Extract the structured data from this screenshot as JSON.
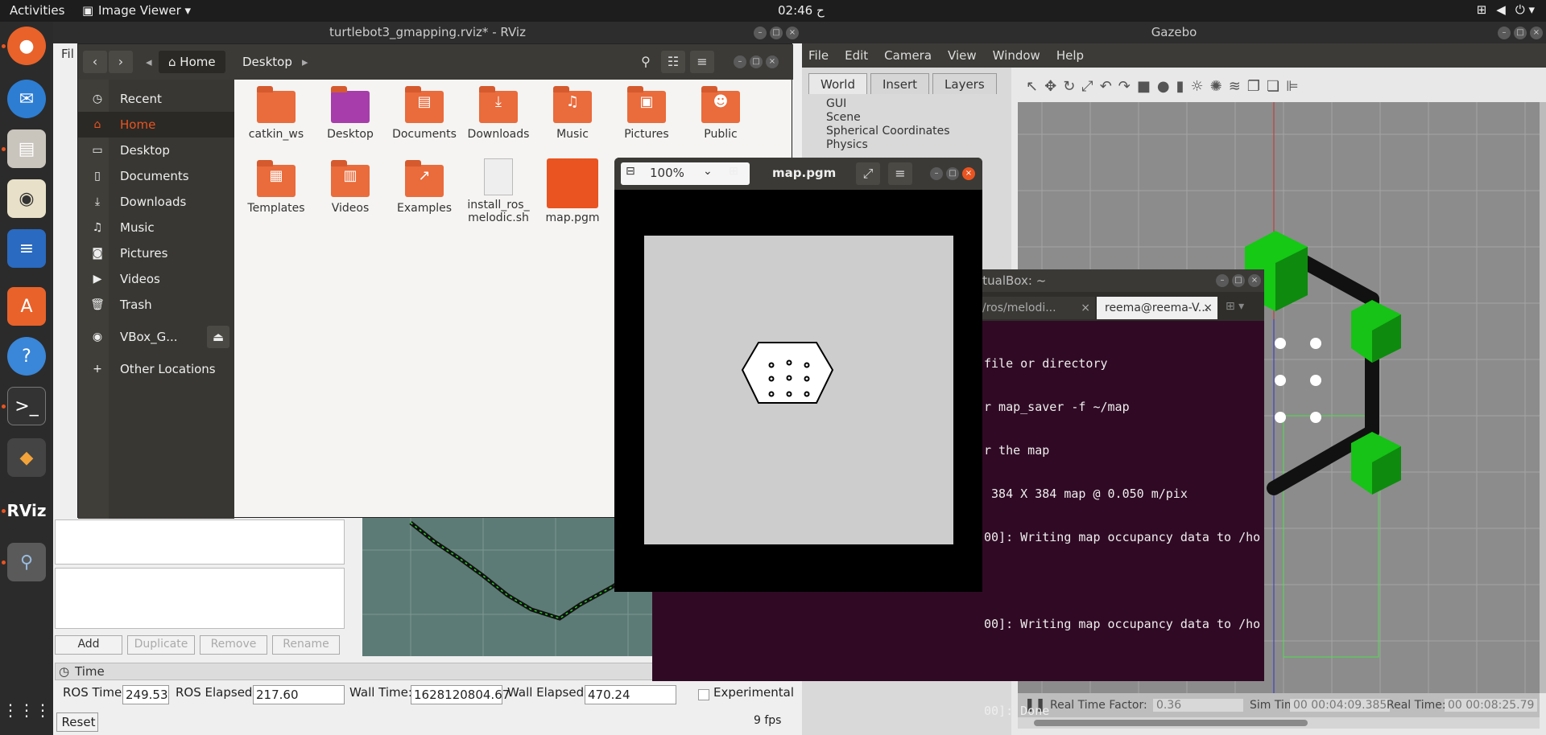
{
  "topbar": {
    "activities": "Activities",
    "app_menu": "Image Viewer ▾",
    "clock": "02:46 ح"
  },
  "dock": {
    "icons": [
      "firefox-icon",
      "thunderbird-icon",
      "files-icon",
      "rhythmbox-icon",
      "writer-icon",
      "software-icon",
      "help-icon",
      "terminal-icon",
      "virtualbox-icon",
      "rviz-icon",
      "image-viewer-icon",
      "app-grid-icon"
    ]
  },
  "rviz": {
    "window_title": "turtlebot3_gmapping.rviz* - RViz",
    "menu_file": "Fil"
  },
  "gazebo": {
    "window_title": "Gazebo",
    "menu": [
      "File",
      "Edit",
      "Camera",
      "View",
      "Window",
      "Help"
    ],
    "tabs": [
      "World",
      "Insert",
      "Layers"
    ],
    "tree": [
      "GUI",
      "Scene",
      "Spherical Coordinates",
      "Physics"
    ],
    "status": {
      "rtf_label": "Real Time Factor:",
      "rtf_value": "0.36",
      "sim_label": "Sim Time:",
      "sim_value": "00 00:04:09.385",
      "real_label": "Real Time:",
      "real_value": "00 00:08:25.79"
    }
  },
  "files": {
    "path_home": "Home",
    "path_desktop": "Desktop",
    "sidebar": [
      {
        "label": "Recent"
      },
      {
        "label": "Home"
      },
      {
        "label": "Desktop"
      },
      {
        "label": "Documents"
      },
      {
        "label": "Downloads"
      },
      {
        "label": "Music"
      },
      {
        "label": "Pictures"
      },
      {
        "label": "Videos"
      },
      {
        "label": "Trash"
      },
      {
        "label": "VBox_G..."
      },
      {
        "label": "Other Locations"
      }
    ],
    "items": [
      {
        "label": "catkin_ws"
      },
      {
        "label": "Desktop"
      },
      {
        "label": "Documents"
      },
      {
        "label": "Downloads"
      },
      {
        "label": "Music"
      },
      {
        "label": "Pictures"
      },
      {
        "label": "Public"
      },
      {
        "label": "Templates"
      },
      {
        "label": "Videos"
      },
      {
        "label": "Examples"
      },
      {
        "label": "install_ros_ melodic.sh"
      },
      {
        "label": "map.pgm"
      }
    ]
  },
  "image_viewer": {
    "zoom": "100%",
    "title": "map.pgm"
  },
  "terminal": {
    "title": "VirtualBox: ~",
    "tab1": "/ros/melodi...",
    "tab2": "reema@reema-V...",
    "lines": [
      "file or directory",
      "r map_saver -f ~/map",
      "r the map",
      " 384 X 384 map @ 0.050 m/pix",
      "00]: Writing map occupancy data to /ho",
      "",
      "00]: Writing map occupancy data to /ho",
      "",
      "00]: Done"
    ]
  },
  "rviz_panel": {
    "buttons": {
      "add": "Add",
      "duplicate": "Duplicate",
      "remove": "Remove",
      "rename": "Rename"
    },
    "time_header": "Time",
    "ros_time_label": "ROS Time:",
    "ros_time": "249.53",
    "ros_elapsed_label": "ROS Elapsed:",
    "ros_elapsed": "217.60",
    "wall_time_label": "Wall Time:",
    "wall_time": "1628120804.67",
    "wall_elapsed_label": "Wall Elapsed:",
    "wall_elapsed": "470.24",
    "experimental": "Experimental",
    "reset": "Reset",
    "fps": "9 fps"
  },
  "colors": {
    "accent": "#e95420",
    "terminal_bg": "#300a24",
    "gazebo_green": "#16c316"
  }
}
